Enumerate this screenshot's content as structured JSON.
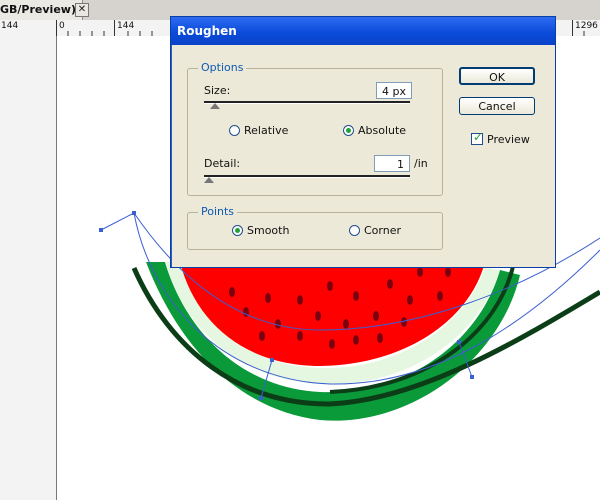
{
  "document_tab": {
    "title": "GB/Preview)",
    "close_glyph": "✕"
  },
  "ruler_top": {
    "labels": [
      "144",
      "0",
      "144",
      "1296"
    ]
  },
  "dialog": {
    "title": "Roughen",
    "options": {
      "group_label": "Options",
      "size_label": "Size:",
      "size_value": "4 px",
      "relative_label": "Relative",
      "absolute_label": "Absolute",
      "mode_selected": "Absolute",
      "detail_label": "Detail:",
      "detail_value": "1",
      "detail_unit": "/in"
    },
    "points": {
      "group_label": "Points",
      "smooth_label": "Smooth",
      "corner_label": "Corner",
      "selected": "Smooth"
    },
    "buttons": {
      "ok": "OK",
      "cancel": "Cancel"
    },
    "preview": {
      "label": "Preview",
      "checked": true
    }
  },
  "colors": {
    "title_bar": "#0a4ad8",
    "dialog_bg": "#ece9d8",
    "group_label": "#0d5ab4",
    "radio_dot": "#22a13a",
    "watermelon_red": "#ff0000",
    "watermelon_green": "#0a9a3a",
    "rind_dark": "#0b3d17",
    "path_blue": "#3a5fd1"
  }
}
